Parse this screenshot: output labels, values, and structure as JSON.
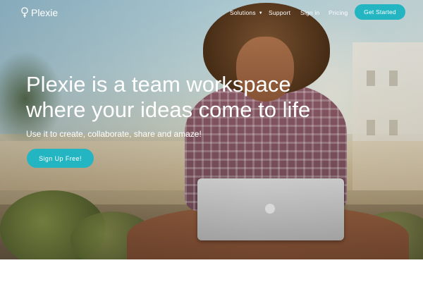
{
  "brand": {
    "name": "Plexie",
    "icon": "plexie-logo-icon"
  },
  "nav": {
    "items": [
      {
        "label": "Solutions",
        "icon": "caret-down-icon"
      },
      {
        "label": "Support"
      },
      {
        "label": "Sign in"
      },
      {
        "label": "Pricing"
      }
    ],
    "cta_label": "Get Started"
  },
  "hero": {
    "headline": "Plexie is a team workspace where your ideas come to life",
    "subline": "Use it to create, collaborate, share and amaze!",
    "cta_label": "Sign Up Free!",
    "background_image": "woman-with-laptop-photo"
  },
  "colors": {
    "accent": "#24b5c2",
    "text_on_image": "#ffffff",
    "page_background": "#ffffff"
  }
}
